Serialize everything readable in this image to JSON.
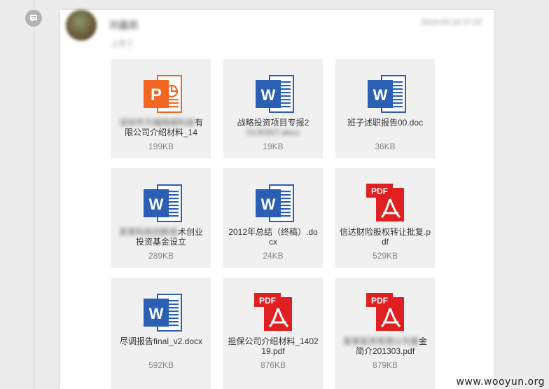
{
  "post": {
    "username": "刘嘉凯",
    "timestamp": "2014-03-14 17:23",
    "subline": "上传了"
  },
  "files": [
    {
      "type": "ppt",
      "name_blurred": "深圳市万维网络科技",
      "name": "有限公司介绍材料_14",
      "size": "199KB"
    },
    {
      "type": "word",
      "name": "战略投资项目专报2",
      "name_blurred": "0130307.docx",
      "size": "19KB"
    },
    {
      "type": "word",
      "name": "班子述职报告00.doc",
      "size": "36KB"
    },
    {
      "type": "word",
      "name_blurred": "某某科技创新技",
      "name": "术创业投资基金设立",
      "size": "289KB"
    },
    {
      "type": "word",
      "name": "2012年总结（终稿）.docx",
      "size": "24KB"
    },
    {
      "type": "pdf",
      "name": "信达财险股权转让批复.pdf",
      "size": "529KB"
    },
    {
      "type": "word",
      "name": "尽调报告final_v2.docx",
      "size": "592KB"
    },
    {
      "type": "pdf",
      "name": "担保公司介绍材料_140219.pdf",
      "size": "876KB"
    },
    {
      "type": "pdf",
      "name_blurred": "某某投资有限公司基",
      "name": "金简介201303.pdf",
      "size": "879KB"
    }
  ],
  "icon_labels": {
    "ppt": "P",
    "word": "W",
    "pdf": "PDF"
  },
  "colors": {
    "ppt": "#f26522",
    "word": "#2b5fb4",
    "pdf": "#e02020"
  },
  "watermark": "www.wooyun.org"
}
